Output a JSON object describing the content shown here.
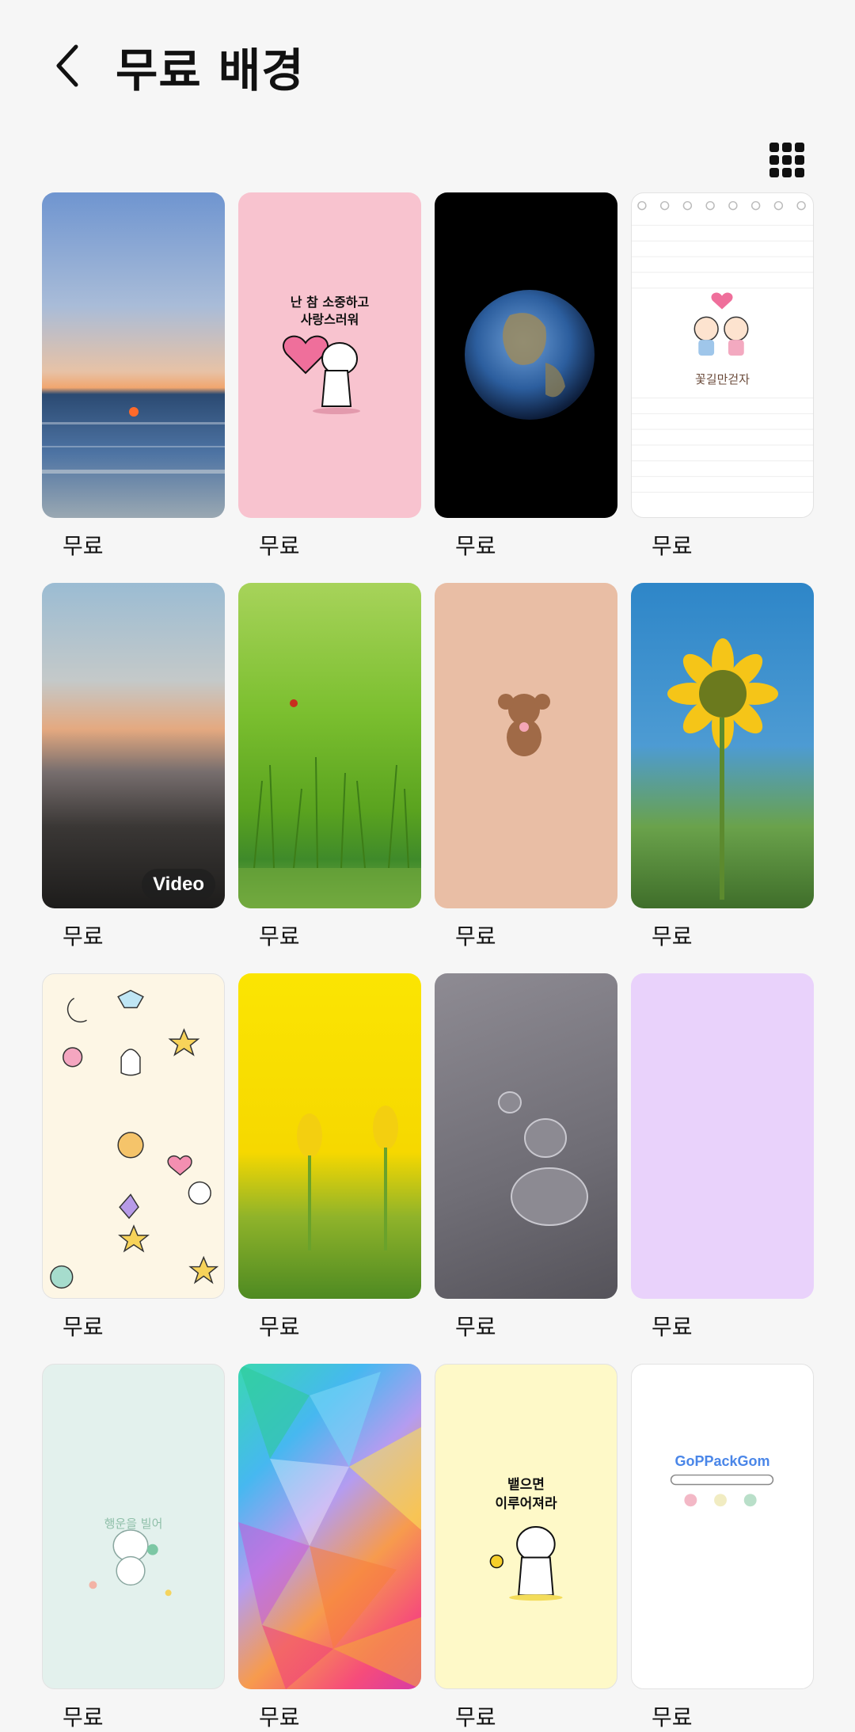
{
  "header": {
    "title": "무료 배경",
    "back_icon": "chevron-left-icon",
    "view_toggle_icon": "grid-view-icon"
  },
  "wallpapers": [
    {
      "name": "sunset-ocean",
      "price": "무료"
    },
    {
      "name": "pink-bear-heart",
      "price": "무료",
      "text": "난 참 소중하고\n사랑스러워"
    },
    {
      "name": "earth",
      "price": "무료"
    },
    {
      "name": "notebook-couple",
      "price": "무료",
      "text": "꽃길만걷자"
    },
    {
      "name": "beach-sunset-video",
      "price": "무료",
      "badge": "Video"
    },
    {
      "name": "grass-ladybug",
      "price": "무료"
    },
    {
      "name": "brown-poodle",
      "price": "무료"
    },
    {
      "name": "sunflower",
      "price": "무료"
    },
    {
      "name": "space-doodles",
      "price": "무료"
    },
    {
      "name": "yellow-tulips",
      "price": "무료"
    },
    {
      "name": "water-drops",
      "price": "무료"
    },
    {
      "name": "lavender-plain",
      "price": "무료"
    },
    {
      "name": "mint-puppy",
      "price": "무료",
      "text": "행운을 빌어"
    },
    {
      "name": "rainbow-polygons",
      "price": "무료"
    },
    {
      "name": "yellow-bear-flower",
      "price": "무료",
      "text": "뱉으면\n이루어져라"
    },
    {
      "name": "gopackgom-home",
      "price": "무료",
      "text": "GoPPackGom"
    }
  ],
  "colors": {
    "background": "#f6f6f6",
    "text": "#111111"
  }
}
